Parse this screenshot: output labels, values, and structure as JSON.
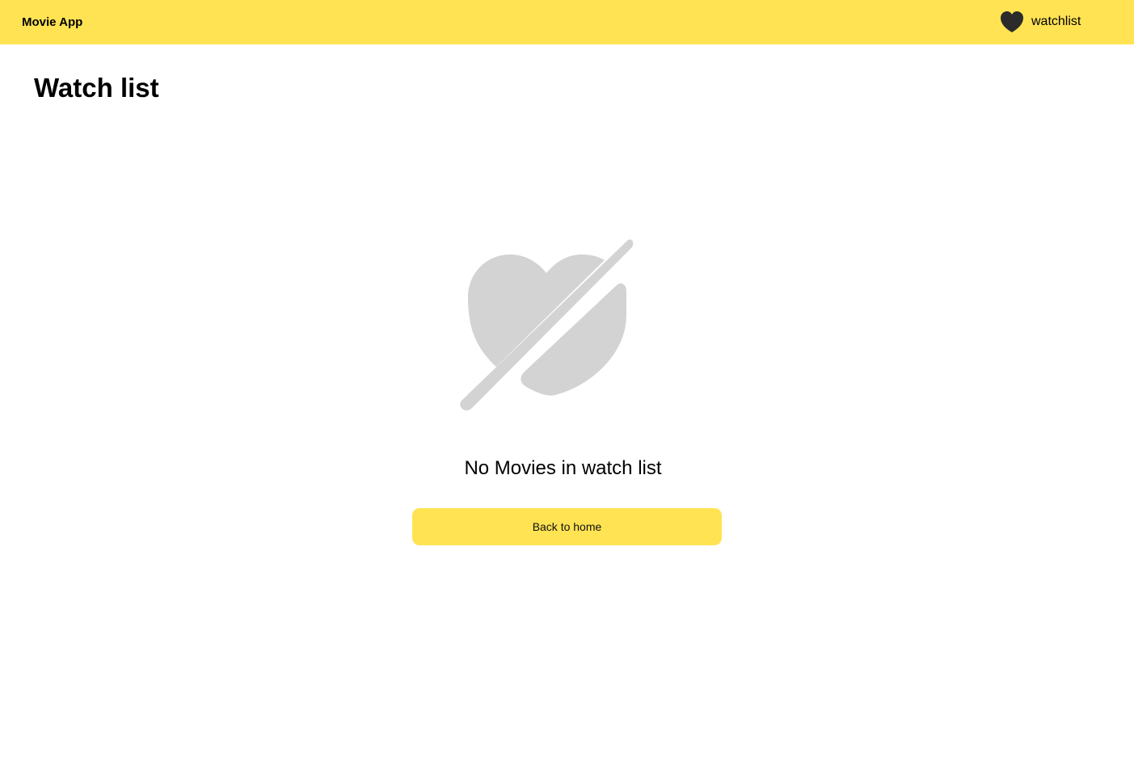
{
  "header": {
    "app_title": "Movie App",
    "watchlist_label": "watchlist",
    "watchlist_icon": "heart-icon",
    "background_color": "#FFE353"
  },
  "main": {
    "page_title": "Watch list",
    "empty_state": {
      "icon": "heart-off-icon",
      "icon_color": "#D3D3D3",
      "message": "No Movies in watch list",
      "button_label": "Back to home"
    }
  }
}
